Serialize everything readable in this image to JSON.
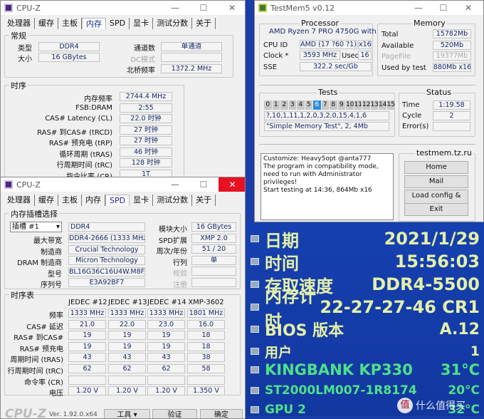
{
  "cpuz1": {
    "title": "CPU-Z",
    "tabs": [
      "处理器",
      "缓存",
      "主板",
      "内存",
      "SPD",
      "显卡",
      "测试分数",
      "关于"
    ],
    "active_tab": 3,
    "general": {
      "title": "常规",
      "type_label": "类型",
      "type": "DDR4",
      "size_label": "大小",
      "size": "16 GBytes",
      "channels_label": "通道数",
      "channels": "单通道",
      "dc_label": "DC模式",
      "dc": "",
      "nb_label": "北桥频率",
      "nb": "1372.2 MHz"
    },
    "timings": {
      "title": "时序",
      "rows": [
        [
          "内存频率",
          "2744.4 MHz"
        ],
        [
          "FSB:DRAM",
          "2:55"
        ],
        [
          "CAS# Latency (CL)",
          "22.0 时钟"
        ],
        [
          "RAS# 到CAS# (tRCD)",
          "27 时钟"
        ],
        [
          "RAS# 预充电 (tRP)",
          "27 时钟"
        ],
        [
          "循环周期 (tRAS)",
          "46 时钟"
        ],
        [
          "行周期时间 (tRC)",
          "128 时钟"
        ],
        [
          "指令比率 (CR)",
          "1T"
        ]
      ]
    }
  },
  "cpuz2": {
    "title": "CPU-Z",
    "tabs": [
      "处理器",
      "缓存",
      "主板",
      "内存",
      "SPD",
      "显卡",
      "测试分数",
      "关于"
    ],
    "active_tab": 4,
    "slot": {
      "title": "内存插槽选择",
      "selected": "插槽 #1",
      "type": "DDR4",
      "left": [
        [
          "最大带宽",
          "DDR4-2666 (1333 MHz)"
        ],
        [
          "制造商",
          "Crucial Technology"
        ],
        [
          "DRAM 制造商",
          "Micron Technology"
        ],
        [
          "型号",
          "BL16G36C16U4W.M8FB1"
        ],
        [
          "序列号",
          "E3A92BF7"
        ]
      ],
      "right": [
        [
          "模块大小",
          "16 GBytes",
          false
        ],
        [
          "SPD扩展",
          "XMP 2.0",
          false
        ],
        [
          "周次/年份",
          "51 / 20",
          false
        ],
        [
          "行列",
          "单",
          false
        ],
        [
          "校验",
          "",
          true
        ],
        [
          "注册",
          "",
          true
        ]
      ]
    },
    "timing_table": {
      "title": "时序表",
      "columns": [
        "JEDEC #12",
        "JEDEC #13",
        "JEDEC #14",
        "XMP-3602"
      ],
      "rows": [
        [
          "频率",
          "1333 MHz",
          "1333 MHz",
          "1333 MHz",
          "1801 MHz"
        ],
        [
          "CAS# 延迟",
          "21.0",
          "22.0",
          "23.0",
          "16.0"
        ],
        [
          "RAS# 到CAS#",
          "19",
          "19",
          "19",
          "18"
        ],
        [
          "RAS# 预充电",
          "19",
          "19",
          "19",
          "18"
        ],
        [
          "周期时间 (tRAS)",
          "43",
          "43",
          "43",
          "38"
        ],
        [
          "行周期时间 (tRC)",
          "62",
          "62",
          "62",
          "58"
        ],
        [
          "命令率 (CR)",
          "",
          "",
          "",
          ""
        ],
        [
          "电压",
          "1.20 V",
          "1.20 V",
          "1.20 V",
          "1.350 V"
        ]
      ]
    },
    "footer": {
      "logo": "CPU-Z",
      "version": "Ver. 1.92.0.x64",
      "tools": "工具",
      "validate": "验证",
      "ok": "确定"
    }
  },
  "testmem": {
    "title": "TestMem5 v0.12",
    "processor": {
      "title": "Processor",
      "name": "AMD Ryzen 7 PRO 4750G with",
      "cpuid_label": "CPU ID",
      "cpuid": "AMD  (17 ?60 ?1)",
      "threads": "x16",
      "clock_label": "Clock *",
      "clock": "3593 MHz",
      "used_label": "Used",
      "used": "16",
      "sse_label": "SSE",
      "sse": "322.2 sec/Gb"
    },
    "memory": {
      "title": "Memory",
      "total_label": "Total",
      "total": "15782Mb",
      "avail_label": "Available",
      "avail": "520Mb",
      "pagefile_label": "PageFile",
      "pagefile": "19377Mb",
      "usedby_label": "Used by test",
      "usedby": "880Mb x16"
    },
    "tests": {
      "title": "Tests",
      "numbers": [
        "0",
        "1",
        "2",
        "3",
        "4",
        "5",
        "6",
        "7",
        "8",
        "9",
        "10",
        "11",
        "12",
        "13",
        "14",
        "15"
      ],
      "active": 6,
      "sequence": "?,10,1,11,1,2,0,3,2,0,15,4,1,6",
      "current": "\"Simple Memory Test\", 2, 4Mb"
    },
    "status": {
      "title": "Status",
      "time_label": "Time",
      "time": "1:19.58",
      "cycle_label": "Cycle",
      "cycle": "2",
      "errors_label": "Error(s)",
      "errors": ""
    },
    "log": [
      "Customize: Heavy5opt @anta777",
      "The program in compatibility mode,",
      "need to run with Administrator privileges!",
      "Start testing at 14:36, 864Mb x16"
    ],
    "links": {
      "title": "testmem.tz.ru",
      "home": "Home",
      "mail": "Mail",
      "load": "Load config & exit",
      "exit": "Exit"
    }
  },
  "aida": {
    "rows": [
      {
        "label": "日期",
        "value": "2021/1/29",
        "icon": "calendar-icon"
      },
      {
        "label": "时间",
        "value": "15:56:03",
        "icon": "clock-icon"
      },
      {
        "label": "存取速度",
        "value": "DDR4-5500",
        "icon": "memory-icon"
      },
      {
        "label": "内存计时",
        "value": "22-27-27-46 CR1",
        "icon": "memory-icon"
      },
      {
        "label": "BIOS 版本",
        "value": "A.12",
        "icon": "chip-icon"
      },
      {
        "label": "用户",
        "value": "1",
        "icon": "user-icon"
      },
      {
        "label": "KINGBANK KP330",
        "value": "31°C",
        "icon": "drive-icon"
      },
      {
        "label": "ST2000LM007-1R8174",
        "value": "20°C",
        "icon": "drive-icon"
      },
      {
        "label": "GPU 2",
        "value": "32°C",
        "icon": "monitor-icon"
      }
    ],
    "colors": {
      "text": "#e4f0a8",
      "drive": "#4fe08a",
      "bg": "#1a3ea8"
    },
    "watermark": "什么值得买"
  }
}
